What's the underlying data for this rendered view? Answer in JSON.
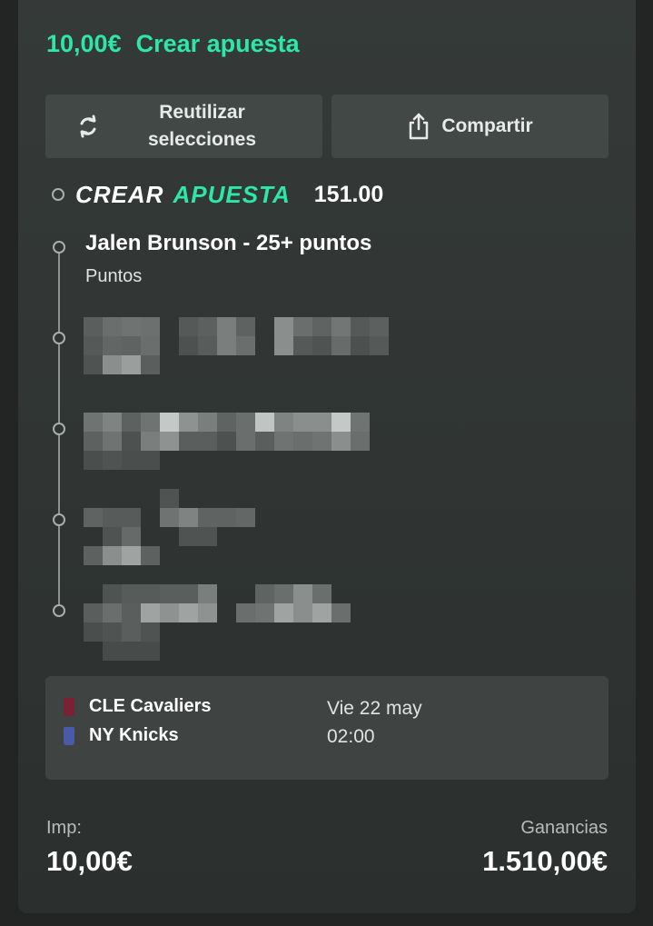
{
  "header": {
    "stake": "10,00€",
    "title": "Crear apuesta"
  },
  "actions": {
    "reuse_label": "Reutilizar\nselecciones",
    "share_label": "Compartir"
  },
  "bet_builder": {
    "title_part1": "CREAR",
    "title_part2": "APUESTA",
    "odds": "151.00"
  },
  "selections": [
    {
      "title": "Jalen Brunson - 25+ puntos",
      "subtitle": "Puntos"
    }
  ],
  "match": {
    "home": {
      "name": "CLE Cavaliers",
      "color": "#7a2233"
    },
    "away": {
      "name": "NY Knicks",
      "color": "#4a5aa8"
    },
    "date": "Vie 22 may",
    "time": "02:00"
  },
  "footer": {
    "stake_label": "Imp:",
    "stake_value": "10,00€",
    "winnings_label": "Ganancias",
    "winnings_value": "1.510,00€"
  },
  "icons": {
    "reuse": "refresh-icon",
    "share": "share-icon"
  },
  "colors": {
    "accent": "#2ee6a8",
    "card": "#353a38",
    "button": "#424846"
  }
}
